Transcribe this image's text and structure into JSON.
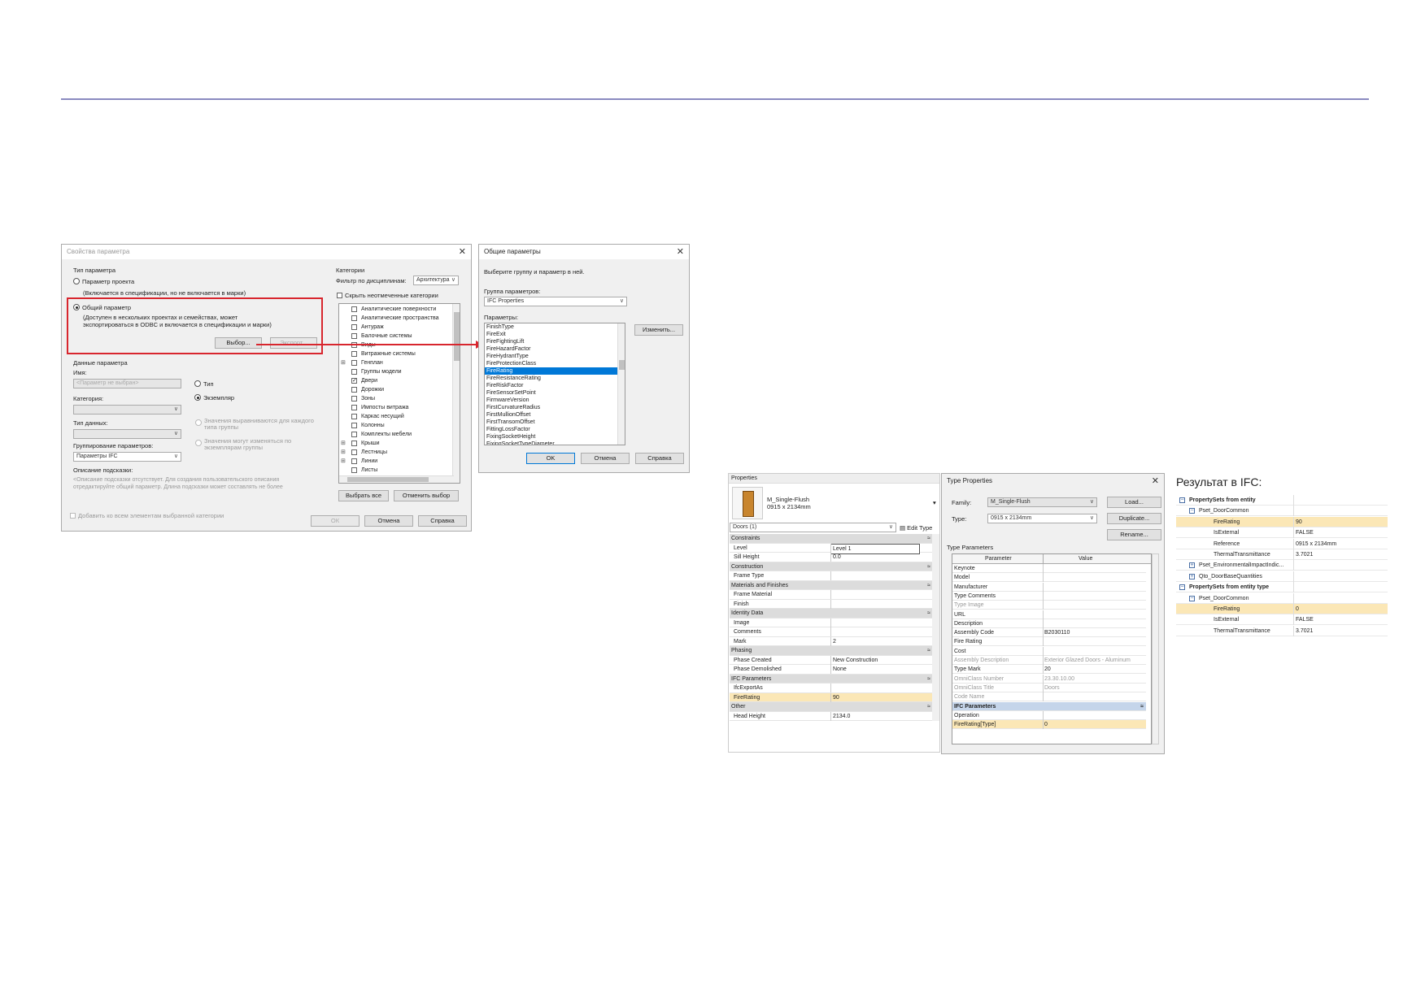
{
  "param_props": {
    "title": "Свойства параметра",
    "type_group": "Тип параметра",
    "project_param": "Параметр проекта",
    "project_param_desc": "(Включается в спецификации, но не включается в марки)",
    "shared_param": "Общий параметр",
    "shared_param_desc1": "(Доступен в нескольких проектах и семействах, может",
    "shared_param_desc2": "экспортироваться в ODBC и включается в спецификации и марки)",
    "select_btn": "Выбор...",
    "export_btn": "Экспорт...",
    "data_group": "Данные параметра",
    "name_label": "Имя:",
    "name_placeholder": "<Параметр не выбран>",
    "type_radio": "Тип",
    "instance_radio": "Экземпляр",
    "category_label": "Категория:",
    "datatype_label": "Тип данных:",
    "align_values": "Значения выравниваются для каждого",
    "align_values2": "типа группы",
    "vary_values": "Значения могут изменяться по",
    "vary_values2": "экземплярам группы",
    "grouping_label": "Группирование параметров:",
    "grouping_value": "Параметры IFC",
    "tooltip_label": "Описание подсказки:",
    "tooltip_text1": "<Описание подсказки отсутствует. Для создания пользовательского описания",
    "tooltip_text2": "отредактируйте общий параметр. Длина подсказки может составлять не более",
    "categories_label": "Категории",
    "filter_label": "Фильтр по дисциплинам:",
    "filter_value": "Архитектура",
    "hide_unchecked": "Скрыть неотмеченные категории",
    "categories": [
      {
        "label": "Аналитические поверхности",
        "checked": false,
        "exp": false
      },
      {
        "label": "Аналитические пространства",
        "checked": false,
        "exp": false
      },
      {
        "label": "Антураж",
        "checked": false,
        "exp": false
      },
      {
        "label": "Балочные системы",
        "checked": false,
        "exp": false
      },
      {
        "label": "Виды",
        "checked": false,
        "exp": false
      },
      {
        "label": "Витражные системы",
        "checked": false,
        "exp": false
      },
      {
        "label": "Генплан",
        "checked": false,
        "exp": true
      },
      {
        "label": "Группы модели",
        "checked": false,
        "exp": false
      },
      {
        "label": "Двери",
        "checked": true,
        "exp": false
      },
      {
        "label": "Дорожки",
        "checked": false,
        "exp": false
      },
      {
        "label": "Зоны",
        "checked": false,
        "exp": false
      },
      {
        "label": "Импосты витража",
        "checked": false,
        "exp": false
      },
      {
        "label": "Каркас несущий",
        "checked": false,
        "exp": false
      },
      {
        "label": "Колонны",
        "checked": false,
        "exp": false
      },
      {
        "label": "Комплекты мебели",
        "checked": false,
        "exp": false
      },
      {
        "label": "Крыши",
        "checked": false,
        "exp": true
      },
      {
        "label": "Лестницы",
        "checked": false,
        "exp": true
      },
      {
        "label": "Линии",
        "checked": false,
        "exp": true
      },
      {
        "label": "Листы",
        "checked": false,
        "exp": false
      }
    ],
    "select_all": "Выбрать все",
    "deselect": "Отменить выбор",
    "add_all": "Добавить ко всем элементам выбранной категории",
    "ok": "ОК",
    "cancel": "Отмена",
    "help": "Справка"
  },
  "shared_params": {
    "title": "Общие параметры",
    "prompt": "Выберите группу и параметр в ней.",
    "group_label": "Группа параметров:",
    "group_value": "IFC Properties",
    "params_label": "Параметры:",
    "edit_btn": "Изменить...",
    "items": [
      "FinishType",
      "FireExit",
      "FireFightingLift",
      "FireHazardFactor",
      "FireHydrantType",
      "FireProtectionClass",
      "FireRating",
      "FireResistanceRating",
      "FireRiskFactor",
      "FireSensorSetPoint",
      "FirmwareVersion",
      "FirstCurvatureRadius",
      "FirstMullionOffset",
      "FirstTransomOffset",
      "FittingLossFactor",
      "FixingSocketHeight",
      "FixingSocketTypeDiameter"
    ],
    "selected_index": 6,
    "ok": "OK",
    "cancel": "Отмена",
    "help": "Справка"
  },
  "properties": {
    "title": "Properties",
    "family_name": "M_Single-Flush",
    "family_size": "0915 x 2134mm",
    "selector": "Doors (1)",
    "edit_type": "Edit Type",
    "rows": [
      {
        "k": "Constraints",
        "v": "",
        "kind": "hdr"
      },
      {
        "k": "Level",
        "v": "Level 1",
        "kind": ""
      },
      {
        "k": "Sill Height",
        "v": "0.0",
        "kind": ""
      },
      {
        "k": "Construction",
        "v": "",
        "kind": "hdr"
      },
      {
        "k": "Frame Type",
        "v": "",
        "kind": ""
      },
      {
        "k": "Materials and Finishes",
        "v": "",
        "kind": "hdr"
      },
      {
        "k": "Frame Material",
        "v": "",
        "kind": ""
      },
      {
        "k": "Finish",
        "v": "",
        "kind": ""
      },
      {
        "k": "Identity Data",
        "v": "",
        "kind": "hdr"
      },
      {
        "k": "Image",
        "v": "",
        "kind": ""
      },
      {
        "k": "Comments",
        "v": "",
        "kind": ""
      },
      {
        "k": "Mark",
        "v": "2",
        "kind": ""
      },
      {
        "k": "Phasing",
        "v": "",
        "kind": "hdr"
      },
      {
        "k": "Phase Created",
        "v": "New Construction",
        "kind": ""
      },
      {
        "k": "Phase Demolished",
        "v": "None",
        "kind": ""
      },
      {
        "k": "IFC Parameters",
        "v": "",
        "kind": "hdr"
      },
      {
        "k": "IfcExportAs",
        "v": "",
        "kind": ""
      },
      {
        "k": "FireRating",
        "v": "90",
        "kind": "hl"
      },
      {
        "k": "Other",
        "v": "",
        "kind": "hdr"
      },
      {
        "k": "Head Height",
        "v": "2134.0",
        "kind": ""
      }
    ]
  },
  "type_props": {
    "title": "Type Properties",
    "family_label": "Family:",
    "family_value": "M_Single-Flush",
    "type_label": "Type:",
    "type_value": "0915 x 2134mm",
    "load": "Load...",
    "duplicate": "Duplicate...",
    "rename": "Rename...",
    "section": "Type Parameters",
    "col_param": "Parameter",
    "col_value": "Value",
    "rows": [
      {
        "k": "Keynote",
        "v": "",
        "kind": ""
      },
      {
        "k": "Model",
        "v": "",
        "kind": ""
      },
      {
        "k": "Manufacturer",
        "v": "",
        "kind": ""
      },
      {
        "k": "Type Comments",
        "v": "",
        "kind": ""
      },
      {
        "k": "Type Image",
        "v": "",
        "kind": "grey"
      },
      {
        "k": "URL",
        "v": "",
        "kind": ""
      },
      {
        "k": "Description",
        "v": "",
        "kind": ""
      },
      {
        "k": "Assembly Code",
        "v": "B2030110",
        "kind": ""
      },
      {
        "k": "Fire Rating",
        "v": "",
        "kind": ""
      },
      {
        "k": "Cost",
        "v": "",
        "kind": ""
      },
      {
        "k": "Assembly Description",
        "v": "Exterior Glazed Doors - Aluminum",
        "kind": "grey"
      },
      {
        "k": "Type Mark",
        "v": "20",
        "kind": ""
      },
      {
        "k": "OmniClass Number",
        "v": "23.30.10.00",
        "kind": "grey"
      },
      {
        "k": "OmniClass Title",
        "v": "Doors",
        "kind": "grey"
      },
      {
        "k": "Code Name",
        "v": "",
        "kind": "grey"
      },
      {
        "k": "IFC Parameters",
        "v": "",
        "kind": "blue"
      },
      {
        "k": "Operation",
        "v": "",
        "kind": ""
      },
      {
        "k": "FireRating[Type]",
        "v": "0",
        "kind": "hl"
      }
    ]
  },
  "ifc_result": {
    "heading": "Результат в IFC:",
    "rows": [
      {
        "label": "PropertySets from entity",
        "value": "",
        "indent": 0,
        "bold": true,
        "toggle": "minus",
        "hl": false
      },
      {
        "label": "Pset_DoorCommon",
        "value": "",
        "indent": 1,
        "bold": false,
        "toggle": "minus",
        "hl": false
      },
      {
        "label": "FireRating",
        "value": "90",
        "indent": 2,
        "bold": false,
        "toggle": "",
        "hl": true
      },
      {
        "label": "IsExternal",
        "value": "FALSE",
        "indent": 2,
        "bold": false,
        "toggle": "",
        "hl": false
      },
      {
        "label": "Reference",
        "value": "0915 x 2134mm",
        "indent": 2,
        "bold": false,
        "toggle": "",
        "hl": false
      },
      {
        "label": "ThermalTransmittance",
        "value": "3.7021",
        "indent": 2,
        "bold": false,
        "toggle": "",
        "hl": false
      },
      {
        "label": "Pset_EnvironmentalImpactIndic...",
        "value": "",
        "indent": 1,
        "bold": false,
        "toggle": "plus",
        "hl": false
      },
      {
        "label": "Qto_DoorBaseQuantities",
        "value": "",
        "indent": 1,
        "bold": false,
        "toggle": "plus",
        "hl": false
      },
      {
        "label": "PropertySets from entity type",
        "value": "",
        "indent": 0,
        "bold": true,
        "toggle": "minus",
        "hl": false
      },
      {
        "label": "Pset_DoorCommon",
        "value": "",
        "indent": 1,
        "bold": false,
        "toggle": "minus",
        "hl": false
      },
      {
        "label": "FireRating",
        "value": "0",
        "indent": 2,
        "bold": false,
        "toggle": "",
        "hl": true
      },
      {
        "label": "IsExternal",
        "value": "FALSE",
        "indent": 2,
        "bold": false,
        "toggle": "",
        "hl": false
      },
      {
        "label": "ThermalTransmittance",
        "value": "3.7021",
        "indent": 2,
        "bold": false,
        "toggle": "",
        "hl": false
      }
    ]
  },
  "colors": {
    "accent": "#0078d7",
    "highlight": "#fbe7b6",
    "red": "#d8262e",
    "rule": "#8a8ac0"
  }
}
